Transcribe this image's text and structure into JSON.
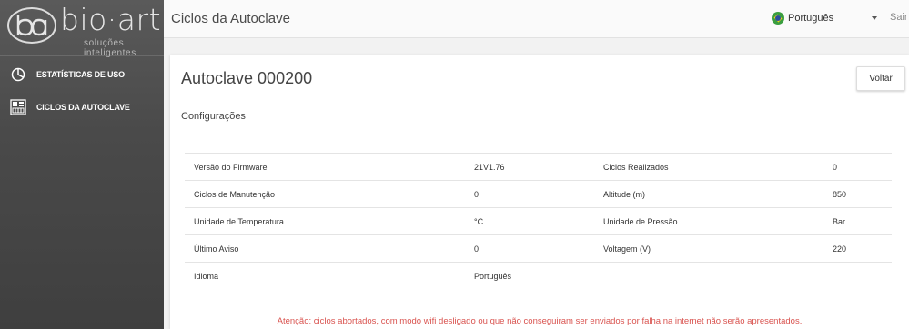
{
  "brand": {
    "name": "bio·art",
    "tagline": "soluções inteligentes"
  },
  "sidebar": {
    "items": [
      {
        "label": "ESTATÍSTICAS DE USO",
        "icon": "pie-chart-icon"
      },
      {
        "label": "CICLOS DA AUTOCLAVE",
        "icon": "autoclave-icon"
      }
    ]
  },
  "topbar": {
    "title": "Ciclos da Autoclave",
    "language": "Português",
    "language_flag": "brazil-flag-icon",
    "logout": "Sair"
  },
  "card": {
    "title": "Autoclave 000200",
    "back_label": "Voltar",
    "section": "Configurações",
    "rows": [
      [
        "Versão do Firmware",
        "21V1.76",
        "Ciclos Realizados",
        "0"
      ],
      [
        "Ciclos de Manutenção",
        "0",
        "Altitude (m)",
        "850"
      ],
      [
        "Unidade de Temperatura",
        "°C",
        "Unidade de Pressão",
        "Bar"
      ],
      [
        "Último Aviso",
        "0",
        "Voltagem (V)",
        "220"
      ],
      [
        "Idioma",
        "Português",
        "",
        ""
      ]
    ],
    "warning": "Atenção: ciclos abortados, com modo wifi desligado ou que não conseguiram ser enviados por falha na internet não serão apresentados."
  },
  "colors": {
    "sidebar": "#4a4a4a",
    "warning": "#d9534f",
    "flag_green": "#3a9e3f"
  }
}
